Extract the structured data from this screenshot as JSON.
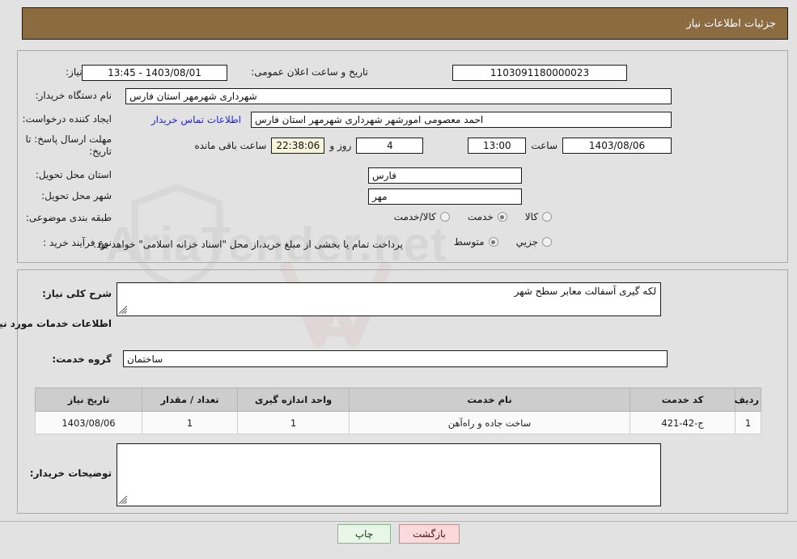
{
  "header": {
    "title": "جزئیات اطلاعات نیاز",
    "bg_color": "#8c6b41",
    "text_color": "#ffffff"
  },
  "form": {
    "need_number": {
      "label": "شماره نیاز:",
      "value": "1103091180000023"
    },
    "public_announce": {
      "label": "تاریخ و ساعت اعلان عمومی:",
      "value": "1403/08/01 - 13:45"
    },
    "buyer_org": {
      "label": "نام دستگاه خریدار:",
      "value": "شهرداری شهرمهر استان فارس"
    },
    "request_creator": {
      "label": "ایجاد کننده درخواست:",
      "value": "احمد  معصومی امورشهر شهرداری شهرمهر استان فارس"
    },
    "contact_link": {
      "label": "اطلاعات تماس خریدار"
    },
    "reply_deadline": {
      "label": "مهلت ارسال پاسخ: تا تاریخ:",
      "date": "1403/08/06",
      "time_label": "ساعت",
      "time": "13:00",
      "days": "4",
      "days_label": "روز و",
      "remaining": "22:38:06",
      "remaining_label": "ساعت باقی مانده"
    },
    "delivery_province": {
      "label": "استان محل تحویل:",
      "value": "فارس"
    },
    "delivery_city": {
      "label": "شهر محل تحویل:",
      "value": "مهر"
    },
    "subject_category": {
      "label": "طبقه بندی موضوعی:",
      "options": [
        {
          "label": "کالا",
          "selected": false
        },
        {
          "label": "خدمت",
          "selected": true
        },
        {
          "label": "کالا/خدمت",
          "selected": false
        }
      ]
    },
    "purchase_process": {
      "label": "نوع فرآیند خرید :",
      "options": [
        {
          "label": "جزیي",
          "selected": false
        },
        {
          "label": "متوسط",
          "selected": true
        }
      ],
      "note": "پرداخت تمام یا بخشی از مبلغ خرید،از محل \"اسناد خزانه اسلامی\" خواهد بود.",
      "checkbox_checked": false
    },
    "general_description": {
      "label": "شرح کلی نیاز:",
      "value": "لکه گیری آسفالت معابر سطح شهر"
    },
    "services_section_title": "اطلاعات خدمات مورد نیاز",
    "service_group": {
      "label": "گروه خدمت:",
      "value": "ساختمان"
    },
    "buyer_notes": {
      "label": "توضیحات خریدار:",
      "value": ""
    }
  },
  "table": {
    "columns": [
      "ردیف",
      "کد خدمت",
      "نام خدمت",
      "واحد اندازه گیری",
      "تعداد / مقدار",
      "تاریخ نیاز"
    ],
    "rows": [
      {
        "row_no": "1",
        "service_code": "ج-42-421",
        "service_name": "ساخت جاده و راه‌آهن",
        "unit": "1",
        "quantity": "1",
        "need_date": "1403/08/06"
      }
    ]
  },
  "buttons": {
    "print": {
      "label": "چاپ",
      "color": "#e7f6e7"
    },
    "back": {
      "label": "بازگشت",
      "color": "#fbd9da"
    }
  },
  "watermark": {
    "text": "AriaTender.net"
  }
}
